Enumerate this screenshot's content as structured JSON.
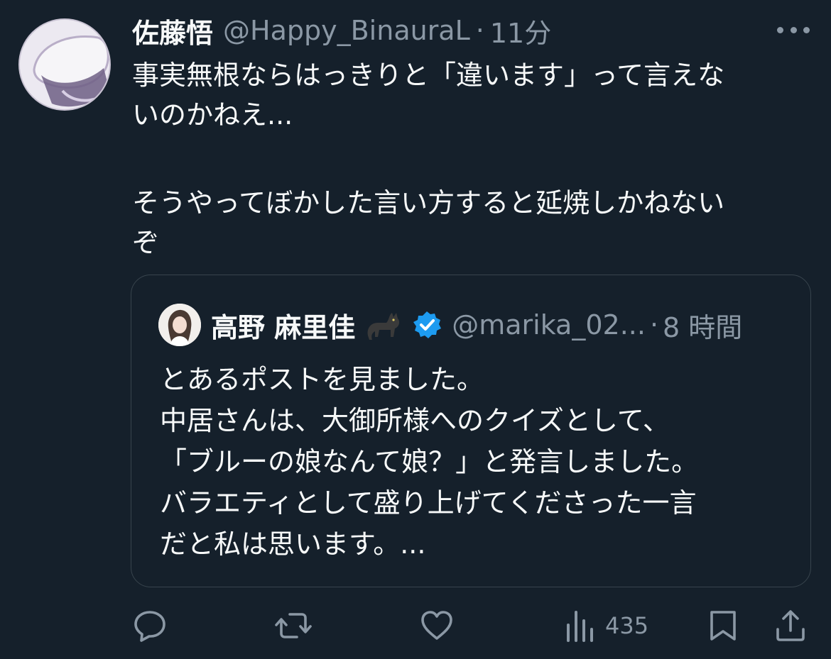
{
  "tweet": {
    "author": {
      "display_name": "佐藤悟",
      "handle": "@Happy_BinauraL",
      "avatar_icon": "abstract-avatar"
    },
    "separator": "·",
    "time": "11分",
    "more_icon": "more-horizontal-icon",
    "text_lines": [
      "事実無根ならはっきりと「違います」って言えな",
      "いのかねえ...",
      "そうやってぼかした言い方すると延焼しかねない",
      "ぞ"
    ]
  },
  "quote": {
    "author": {
      "display_name": "高野 麻里佳",
      "emoji_icon": "black-cat-icon",
      "verified_icon": "verified-badge-icon",
      "handle": "@marika_02...",
      "avatar_icon": "profile-photo"
    },
    "separator": "·",
    "time": "8 時間",
    "text_lines": [
      "とあるポストを見ました。",
      "中居さんは、大御所様へのクイズとして、",
      "「ブルーの娘なんて娘？」と発言しました。",
      "バラエティとして盛り上げてくださった一言",
      "だと私は思います。..."
    ]
  },
  "actions": {
    "reply_icon": "reply-icon",
    "retweet_icon": "retweet-icon",
    "like_icon": "heart-icon",
    "views_icon": "views-icon",
    "views_count": "435",
    "bookmark_icon": "bookmark-icon",
    "share_icon": "share-icon"
  },
  "colors": {
    "background": "#15202b",
    "text_primary": "#f7f9f9",
    "text_secondary": "#8b98a5",
    "border": "#38444d",
    "verified": "#1d9bf0"
  }
}
